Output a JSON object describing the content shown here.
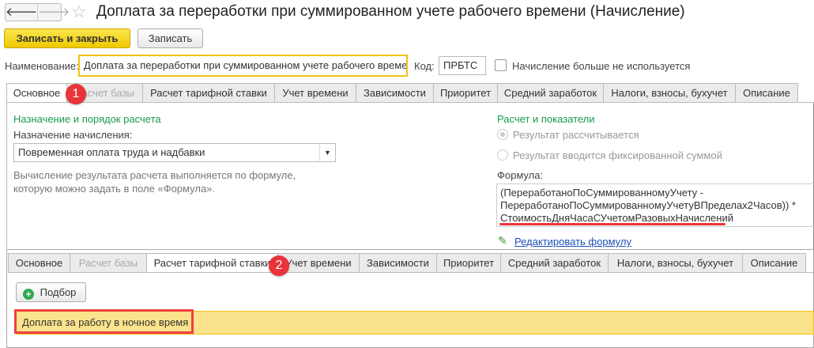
{
  "window": {
    "title": "Доплата за переработки при суммированном учете рабочего времени (Начисление)",
    "back": "🡐",
    "forward": "🡒",
    "star": "☆"
  },
  "toolbar": {
    "save_close": "Записать и закрыть",
    "save": "Записать"
  },
  "form": {
    "name_label": "Наименование:",
    "name_value": "Доплата за переработки при суммированном учете рабочего време",
    "code_label": "Код:",
    "code_value": "ПРБТС",
    "unused_label": "Начисление больше не используется"
  },
  "tabs": [
    "Основное",
    "Расчет базы",
    "Расчет тарифной ставки",
    "Учет времени",
    "Зависимости",
    "Приоритет",
    "Средний заработок",
    "Налоги, взносы, бухучет",
    "Описание"
  ],
  "main": {
    "section_left": "Назначение и порядок расчета",
    "purpose_label": "Назначение начисления:",
    "purpose_value": "Повременная оплата труда и надбавки",
    "hint": [
      "Вычисление результата расчета выполняется по формуле,",
      "которую можно задать в поле «Формула»."
    ],
    "section_right": "Расчет и показатели",
    "radio1": "Результат рассчитывается",
    "radio2": "Результат вводится фиксированной суммой",
    "formula_label": "Формула:",
    "formula_lines": [
      "(ПереработаноПоСуммированномуУчету -",
      "ПереработаноПоСуммированномуУчетуВПределах2Часов)) *",
      "СтоимостьДняЧасаСУчетомРазовыхНачислений"
    ],
    "edit_formula": "Редактировать формулу"
  },
  "second": {
    "pick_button": "Подбор",
    "row": "Доплата за работу в ночное время"
  },
  "badges": [
    "1",
    "2"
  ]
}
